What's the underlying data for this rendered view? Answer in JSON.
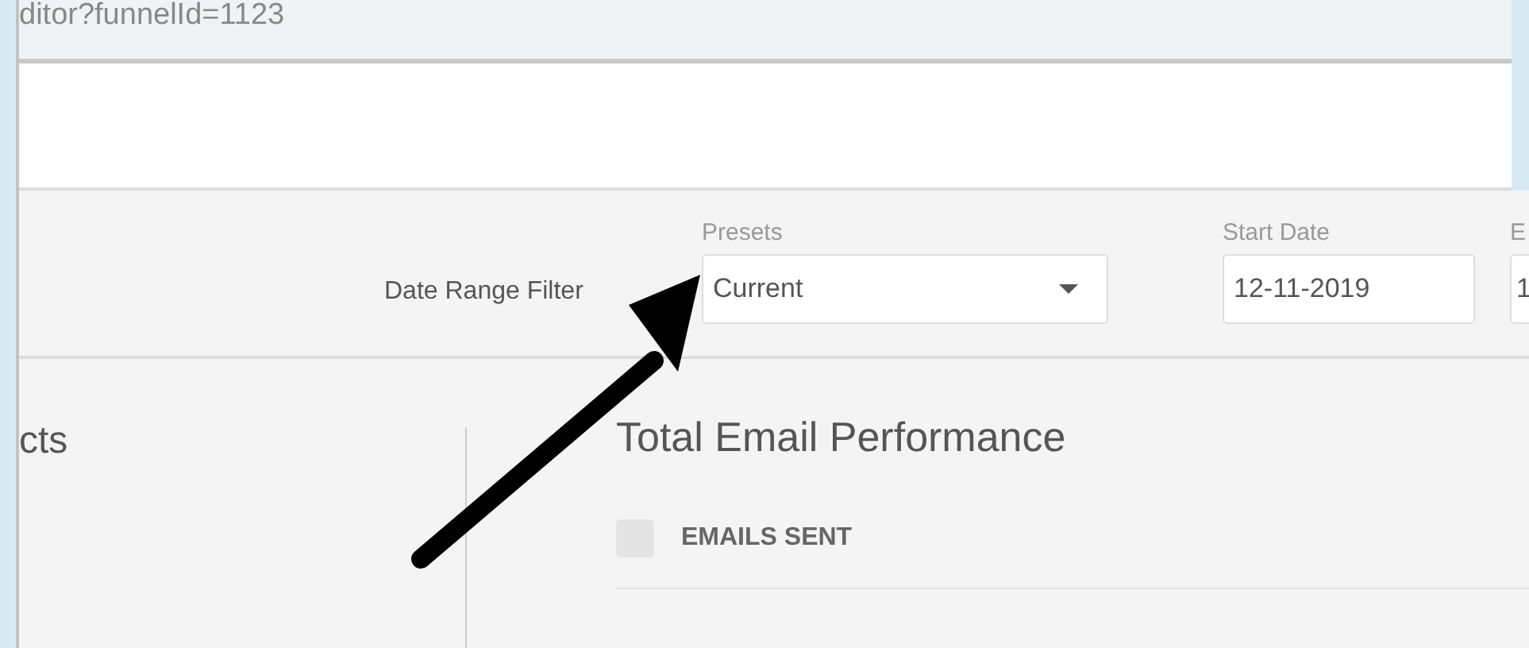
{
  "address_bar": {
    "url": "ditor?funnelId=1123"
  },
  "filter_bar": {
    "label": "Date Range Filter",
    "presets": {
      "label": "Presets",
      "value": "Current"
    },
    "start_date": {
      "label": "Start Date",
      "value": "12-11-2019"
    },
    "end_date": {
      "label": "E",
      "value": "1"
    }
  },
  "sidebar": {
    "heading": "cts"
  },
  "panel": {
    "title": "Total Email Performance",
    "metrics": [
      {
        "label": "EMAILS SENT",
        "checked": false
      }
    ]
  }
}
